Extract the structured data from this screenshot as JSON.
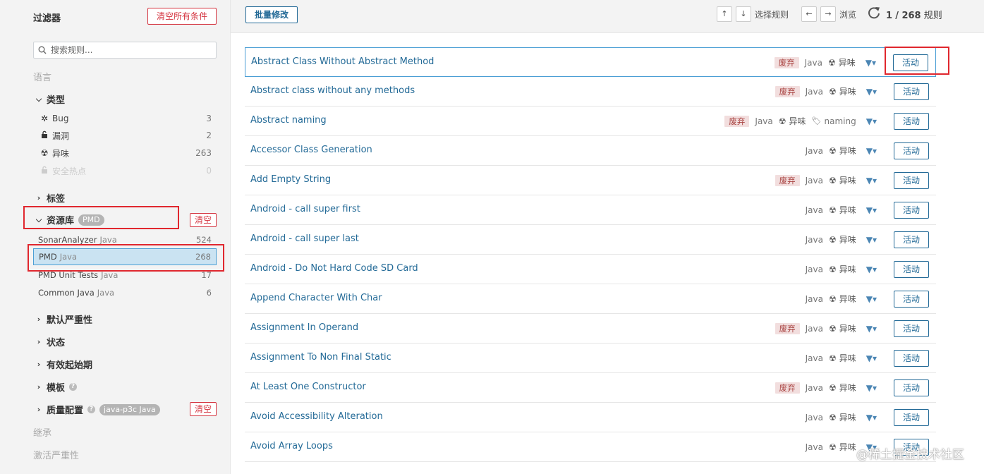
{
  "sidebar": {
    "title": "过滤器",
    "clear_all": "清空所有条件",
    "search_placeholder": "搜索规则...",
    "language_label": "语言",
    "type": {
      "heading": "类型",
      "items": [
        {
          "label": "Bug",
          "count": "3",
          "icon": "bug-icon"
        },
        {
          "label": "漏洞",
          "count": "2",
          "icon": "lock-icon"
        },
        {
          "label": "异味",
          "count": "263",
          "icon": "smell-icon"
        },
        {
          "label": "安全热点",
          "count": "0",
          "icon": "hotspot-icon"
        }
      ]
    },
    "tags_heading": "标签",
    "repository": {
      "heading": "资源库",
      "pill": "PMD",
      "clear": "清空",
      "items": [
        {
          "label": "SonarAnalyzer",
          "lang": "Java",
          "count": "524"
        },
        {
          "label": "PMD",
          "lang": "Java",
          "count": "268"
        },
        {
          "label": "PMD Unit Tests",
          "lang": "Java",
          "count": "17"
        },
        {
          "label": "Common Java",
          "lang": "Java",
          "count": "6"
        }
      ]
    },
    "severity_heading": "默认严重性",
    "status_heading": "状态",
    "available_since_heading": "有效起始期",
    "template_heading": "模板",
    "quality_profile": {
      "heading": "质量配置",
      "pill": "java-p3c Java",
      "clear": "清空"
    },
    "inheritance_label": "继承",
    "activation_severity_label": "激活严重性"
  },
  "toolbar": {
    "bulk_change": "批量修改",
    "up_key": "↑",
    "down_key": "↓",
    "select_rule": "选择规则",
    "left_key": "←",
    "right_key": "→",
    "browse": "浏览",
    "counter_current": "1",
    "counter_total": "/ 268",
    "counter_unit": "规则"
  },
  "rules": [
    {
      "name": "Abstract Class Without Abstract Method",
      "deprecated": "废弃",
      "lang": "Java",
      "type": "异味",
      "action": "活动"
    },
    {
      "name": "Abstract class without any methods",
      "deprecated": "废弃",
      "lang": "Java",
      "type": "异味",
      "action": "活动"
    },
    {
      "name": "Abstract naming",
      "deprecated": "废弃",
      "lang": "Java",
      "type": "异味",
      "tag": "naming",
      "action": "活动"
    },
    {
      "name": "Accessor Class Generation",
      "lang": "Java",
      "type": "异味",
      "action": "活动"
    },
    {
      "name": "Add Empty String",
      "deprecated": "废弃",
      "lang": "Java",
      "type": "异味",
      "action": "活动"
    },
    {
      "name": "Android - call super first",
      "lang": "Java",
      "type": "异味",
      "action": "活动"
    },
    {
      "name": "Android - call super last",
      "lang": "Java",
      "type": "异味",
      "action": "活动"
    },
    {
      "name": "Android - Do Not Hard Code SD Card",
      "lang": "Java",
      "type": "异味",
      "action": "活动"
    },
    {
      "name": "Append Character With Char",
      "lang": "Java",
      "type": "异味",
      "action": "活动"
    },
    {
      "name": "Assignment In Operand",
      "deprecated": "废弃",
      "lang": "Java",
      "type": "异味",
      "action": "活动"
    },
    {
      "name": "Assignment To Non Final Static",
      "lang": "Java",
      "type": "异味",
      "action": "活动"
    },
    {
      "name": "At Least One Constructor",
      "deprecated": "废弃",
      "lang": "Java",
      "type": "异味",
      "action": "活动"
    },
    {
      "name": "Avoid Accessibility Alteration",
      "lang": "Java",
      "type": "异味",
      "action": "活动"
    },
    {
      "name": "Avoid Array Loops",
      "lang": "Java",
      "type": "异味",
      "action": "活动"
    }
  ],
  "watermark": "@稀土掘金技术社区"
}
